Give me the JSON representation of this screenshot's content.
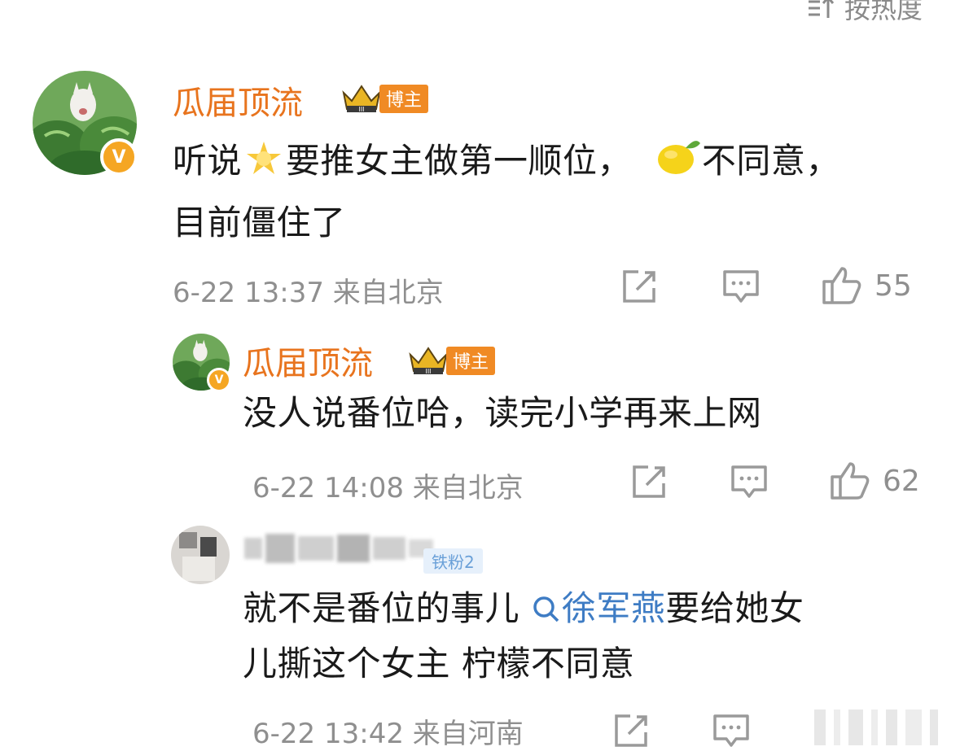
{
  "sort": {
    "label": "按热度"
  },
  "comments": [
    {
      "username": "瓜届顶流",
      "role_tag": "博主",
      "text_before_sun": "听说",
      "text_middle": "要推女主做第一顺位，",
      "text_after_lemon": "不同意，",
      "text_line2": "目前僵住了",
      "time": "6-22 13:37",
      "location": "来自北京",
      "likes": "55"
    },
    {
      "username": "瓜届顶流",
      "role_tag": "博主",
      "text": "没人说番位哈，读完小学再来上网",
      "time": "6-22 14:08",
      "location": "来自北京",
      "likes": "62"
    },
    {
      "role_tag": "铁粉2",
      "text_before_mention": "就不是番位的事儿 ",
      "mention": "徐军燕",
      "text_after_mention": "要给她女",
      "text_line2": "儿撕这个女主 柠檬不同意",
      "time": "6-22 13:42",
      "location": "来自河南"
    }
  ],
  "colors": {
    "username": "#e8741e",
    "mention": "#3e7cc4",
    "meta": "#8f8f8f",
    "badge": "#f08a24"
  }
}
